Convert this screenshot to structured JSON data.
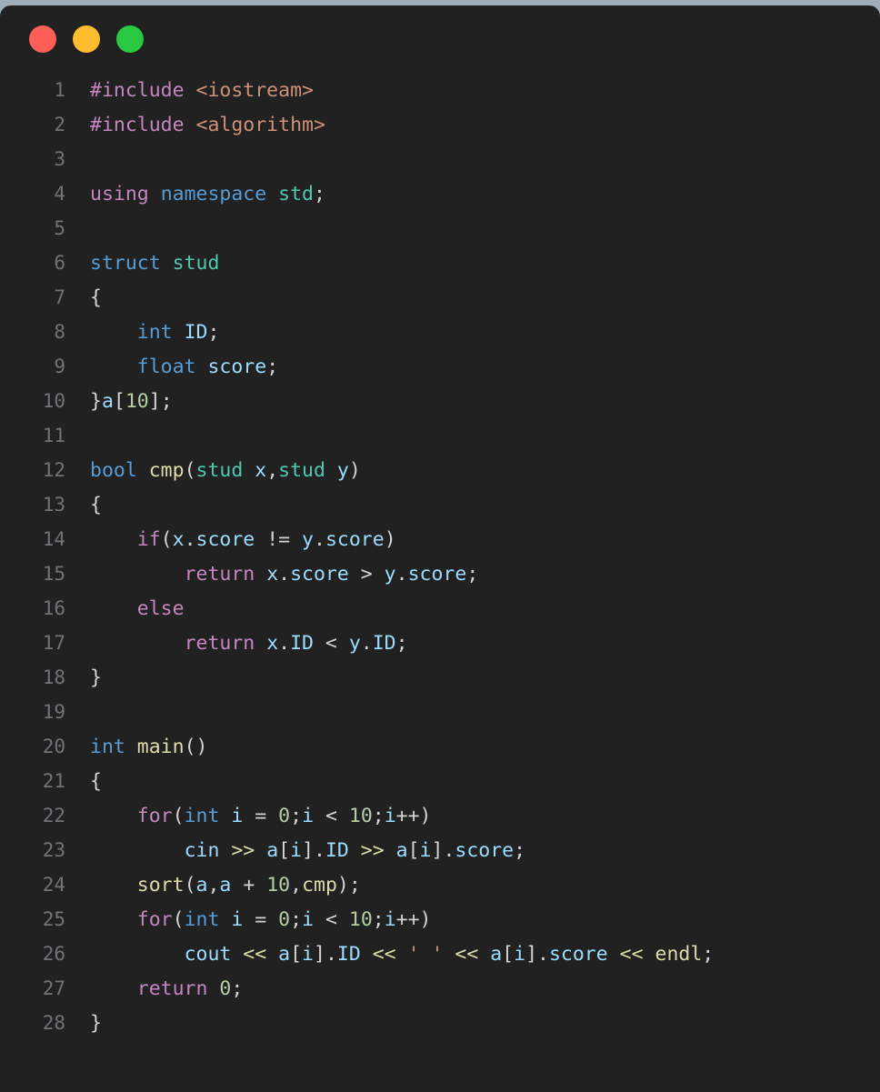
{
  "window": {
    "background_color": "#212121",
    "page_background_color": "#9FADB9",
    "traffic_lights": [
      {
        "name": "close",
        "color": "#FF5F57",
        "label": "Close"
      },
      {
        "name": "minimize",
        "color": "#FEBC2E",
        "label": "Minimize"
      },
      {
        "name": "maximize",
        "color": "#28C840",
        "label": "Maximize"
      }
    ]
  },
  "editor": {
    "language": "C++",
    "theme": "dark",
    "line_number_color": "#6F7478",
    "total_lines": 28,
    "lines": [
      {
        "n": "1",
        "text": "#include <iostream>"
      },
      {
        "n": "2",
        "text": "#include <algorithm>"
      },
      {
        "n": "3",
        "text": ""
      },
      {
        "n": "4",
        "text": "using namespace std;"
      },
      {
        "n": "5",
        "text": ""
      },
      {
        "n": "6",
        "text": "struct stud"
      },
      {
        "n": "7",
        "text": "{"
      },
      {
        "n": "8",
        "text": "    int ID;"
      },
      {
        "n": "9",
        "text": "    float score;"
      },
      {
        "n": "10",
        "text": "}a[10];"
      },
      {
        "n": "11",
        "text": ""
      },
      {
        "n": "12",
        "text": "bool cmp(stud x,stud y)"
      },
      {
        "n": "13",
        "text": "{"
      },
      {
        "n": "14",
        "text": "    if(x.score != y.score)"
      },
      {
        "n": "15",
        "text": "        return x.score > y.score;"
      },
      {
        "n": "16",
        "text": "    else"
      },
      {
        "n": "17",
        "text": "        return x.ID < y.ID;"
      },
      {
        "n": "18",
        "text": "}"
      },
      {
        "n": "19",
        "text": ""
      },
      {
        "n": "20",
        "text": "int main()"
      },
      {
        "n": "21",
        "text": "{"
      },
      {
        "n": "22",
        "text": "    for(int i = 0;i < 10;i++)"
      },
      {
        "n": "23",
        "text": "        cin >> a[i].ID >> a[i].score;"
      },
      {
        "n": "24",
        "text": "    sort(a,a + 10,cmp);"
      },
      {
        "n": "25",
        "text": "    for(int i = 0;i < 10;i++)"
      },
      {
        "n": "26",
        "text": "        cout << a[i].ID << ' ' << a[i].score << endl;"
      },
      {
        "n": "27",
        "text": "    return 0;"
      },
      {
        "n": "28",
        "text": "}"
      }
    ],
    "tokens": [
      [
        {
          "t": "#include",
          "c": "t-pre"
        },
        {
          "t": " ",
          "c": "t-op"
        },
        {
          "t": "<iostream>",
          "c": "t-str"
        }
      ],
      [
        {
          "t": "#include",
          "c": "t-pre"
        },
        {
          "t": " ",
          "c": "t-op"
        },
        {
          "t": "<algorithm>",
          "c": "t-str"
        }
      ],
      [],
      [
        {
          "t": "using",
          "c": "t-pre"
        },
        {
          "t": " ",
          "c": "t-op"
        },
        {
          "t": "namespace",
          "c": "t-kw"
        },
        {
          "t": " ",
          "c": "t-op"
        },
        {
          "t": "std",
          "c": "t-type"
        },
        {
          "t": ";",
          "c": "t-op"
        }
      ],
      [],
      [
        {
          "t": "struct",
          "c": "t-kw"
        },
        {
          "t": " ",
          "c": "t-op"
        },
        {
          "t": "stud",
          "c": "t-type"
        }
      ],
      [
        {
          "t": "{",
          "c": "t-op"
        }
      ],
      [
        {
          "t": "    ",
          "c": "t-op"
        },
        {
          "t": "int",
          "c": "t-kw"
        },
        {
          "t": " ",
          "c": "t-op"
        },
        {
          "t": "ID",
          "c": "t-var"
        },
        {
          "t": ";",
          "c": "t-op"
        }
      ],
      [
        {
          "t": "    ",
          "c": "t-op"
        },
        {
          "t": "float",
          "c": "t-kw"
        },
        {
          "t": " ",
          "c": "t-op"
        },
        {
          "t": "score",
          "c": "t-var"
        },
        {
          "t": ";",
          "c": "t-op"
        }
      ],
      [
        {
          "t": "}",
          "c": "t-op"
        },
        {
          "t": "a",
          "c": "t-var"
        },
        {
          "t": "[",
          "c": "t-op"
        },
        {
          "t": "10",
          "c": "t-num"
        },
        {
          "t": "];",
          "c": "t-op"
        }
      ],
      [],
      [
        {
          "t": "bool",
          "c": "t-kw"
        },
        {
          "t": " ",
          "c": "t-op"
        },
        {
          "t": "cmp",
          "c": "t-fn"
        },
        {
          "t": "(",
          "c": "t-op"
        },
        {
          "t": "stud",
          "c": "t-type"
        },
        {
          "t": " ",
          "c": "t-op"
        },
        {
          "t": "x",
          "c": "t-var"
        },
        {
          "t": ",",
          "c": "t-op"
        },
        {
          "t": "stud",
          "c": "t-type"
        },
        {
          "t": " ",
          "c": "t-op"
        },
        {
          "t": "y",
          "c": "t-var"
        },
        {
          "t": ")",
          "c": "t-op"
        }
      ],
      [
        {
          "t": "{",
          "c": "t-op"
        }
      ],
      [
        {
          "t": "    ",
          "c": "t-op"
        },
        {
          "t": "if",
          "c": "t-ctl"
        },
        {
          "t": "(",
          "c": "t-op"
        },
        {
          "t": "x",
          "c": "t-var"
        },
        {
          "t": ".",
          "c": "t-op"
        },
        {
          "t": "score",
          "c": "t-var"
        },
        {
          "t": " != ",
          "c": "t-op"
        },
        {
          "t": "y",
          "c": "t-var"
        },
        {
          "t": ".",
          "c": "t-op"
        },
        {
          "t": "score",
          "c": "t-var"
        },
        {
          "t": ")",
          "c": "t-op"
        }
      ],
      [
        {
          "t": "        ",
          "c": "t-op"
        },
        {
          "t": "return",
          "c": "t-ctl"
        },
        {
          "t": " ",
          "c": "t-op"
        },
        {
          "t": "x",
          "c": "t-var"
        },
        {
          "t": ".",
          "c": "t-op"
        },
        {
          "t": "score",
          "c": "t-var"
        },
        {
          "t": " > ",
          "c": "t-op"
        },
        {
          "t": "y",
          "c": "t-var"
        },
        {
          "t": ".",
          "c": "t-op"
        },
        {
          "t": "score",
          "c": "t-var"
        },
        {
          "t": ";",
          "c": "t-op"
        }
      ],
      [
        {
          "t": "    ",
          "c": "t-op"
        },
        {
          "t": "else",
          "c": "t-ctl"
        }
      ],
      [
        {
          "t": "        ",
          "c": "t-op"
        },
        {
          "t": "return",
          "c": "t-ctl"
        },
        {
          "t": " ",
          "c": "t-op"
        },
        {
          "t": "x",
          "c": "t-var"
        },
        {
          "t": ".",
          "c": "t-op"
        },
        {
          "t": "ID",
          "c": "t-var"
        },
        {
          "t": " < ",
          "c": "t-op"
        },
        {
          "t": "y",
          "c": "t-var"
        },
        {
          "t": ".",
          "c": "t-op"
        },
        {
          "t": "ID",
          "c": "t-var"
        },
        {
          "t": ";",
          "c": "t-op"
        }
      ],
      [
        {
          "t": "}",
          "c": "t-op"
        }
      ],
      [],
      [
        {
          "t": "int",
          "c": "t-kw"
        },
        {
          "t": " ",
          "c": "t-op"
        },
        {
          "t": "main",
          "c": "t-fn"
        },
        {
          "t": "()",
          "c": "t-op"
        }
      ],
      [
        {
          "t": "{",
          "c": "t-op"
        }
      ],
      [
        {
          "t": "    ",
          "c": "t-op"
        },
        {
          "t": "for",
          "c": "t-ctl"
        },
        {
          "t": "(",
          "c": "t-op"
        },
        {
          "t": "int",
          "c": "t-kw"
        },
        {
          "t": " ",
          "c": "t-op"
        },
        {
          "t": "i",
          "c": "t-var"
        },
        {
          "t": " = ",
          "c": "t-op"
        },
        {
          "t": "0",
          "c": "t-num"
        },
        {
          "t": ";",
          "c": "t-op"
        },
        {
          "t": "i",
          "c": "t-var"
        },
        {
          "t": " < ",
          "c": "t-op"
        },
        {
          "t": "10",
          "c": "t-num"
        },
        {
          "t": ";",
          "c": "t-op"
        },
        {
          "t": "i",
          "c": "t-var"
        },
        {
          "t": "++)",
          "c": "t-op"
        }
      ],
      [
        {
          "t": "        ",
          "c": "t-op"
        },
        {
          "t": "cin",
          "c": "t-var"
        },
        {
          "t": " ",
          "c": "t-op"
        },
        {
          "t": ">>",
          "c": "t-strop"
        },
        {
          "t": " ",
          "c": "t-op"
        },
        {
          "t": "a",
          "c": "t-var"
        },
        {
          "t": "[",
          "c": "t-op"
        },
        {
          "t": "i",
          "c": "t-var"
        },
        {
          "t": "].",
          "c": "t-op"
        },
        {
          "t": "ID",
          "c": "t-var"
        },
        {
          "t": " ",
          "c": "t-op"
        },
        {
          "t": ">>",
          "c": "t-strop"
        },
        {
          "t": " ",
          "c": "t-op"
        },
        {
          "t": "a",
          "c": "t-var"
        },
        {
          "t": "[",
          "c": "t-op"
        },
        {
          "t": "i",
          "c": "t-var"
        },
        {
          "t": "].",
          "c": "t-op"
        },
        {
          "t": "score",
          "c": "t-var"
        },
        {
          "t": ";",
          "c": "t-op"
        }
      ],
      [
        {
          "t": "    ",
          "c": "t-op"
        },
        {
          "t": "sort",
          "c": "t-fn"
        },
        {
          "t": "(",
          "c": "t-op"
        },
        {
          "t": "a",
          "c": "t-var"
        },
        {
          "t": ",",
          "c": "t-op"
        },
        {
          "t": "a",
          "c": "t-var"
        },
        {
          "t": " + ",
          "c": "t-op"
        },
        {
          "t": "10",
          "c": "t-num"
        },
        {
          "t": ",",
          "c": "t-op"
        },
        {
          "t": "cmp",
          "c": "t-fn"
        },
        {
          "t": ");",
          "c": "t-op"
        }
      ],
      [
        {
          "t": "    ",
          "c": "t-op"
        },
        {
          "t": "for",
          "c": "t-ctl"
        },
        {
          "t": "(",
          "c": "t-op"
        },
        {
          "t": "int",
          "c": "t-kw"
        },
        {
          "t": " ",
          "c": "t-op"
        },
        {
          "t": "i",
          "c": "t-var"
        },
        {
          "t": " = ",
          "c": "t-op"
        },
        {
          "t": "0",
          "c": "t-num"
        },
        {
          "t": ";",
          "c": "t-op"
        },
        {
          "t": "i",
          "c": "t-var"
        },
        {
          "t": " < ",
          "c": "t-op"
        },
        {
          "t": "10",
          "c": "t-num"
        },
        {
          "t": ";",
          "c": "t-op"
        },
        {
          "t": "i",
          "c": "t-var"
        },
        {
          "t": "++)",
          "c": "t-op"
        }
      ],
      [
        {
          "t": "        ",
          "c": "t-op"
        },
        {
          "t": "cout",
          "c": "t-var"
        },
        {
          "t": " ",
          "c": "t-op"
        },
        {
          "t": "<<",
          "c": "t-strop"
        },
        {
          "t": " ",
          "c": "t-op"
        },
        {
          "t": "a",
          "c": "t-var"
        },
        {
          "t": "[",
          "c": "t-op"
        },
        {
          "t": "i",
          "c": "t-var"
        },
        {
          "t": "].",
          "c": "t-op"
        },
        {
          "t": "ID",
          "c": "t-var"
        },
        {
          "t": " ",
          "c": "t-op"
        },
        {
          "t": "<<",
          "c": "t-strop"
        },
        {
          "t": " ",
          "c": "t-op"
        },
        {
          "t": "' '",
          "c": "t-str"
        },
        {
          "t": " ",
          "c": "t-op"
        },
        {
          "t": "<<",
          "c": "t-strop"
        },
        {
          "t": " ",
          "c": "t-op"
        },
        {
          "t": "a",
          "c": "t-var"
        },
        {
          "t": "[",
          "c": "t-op"
        },
        {
          "t": "i",
          "c": "t-var"
        },
        {
          "t": "].",
          "c": "t-op"
        },
        {
          "t": "score",
          "c": "t-var"
        },
        {
          "t": " ",
          "c": "t-op"
        },
        {
          "t": "<<",
          "c": "t-strop"
        },
        {
          "t": " ",
          "c": "t-op"
        },
        {
          "t": "endl",
          "c": "t-fn"
        },
        {
          "t": ";",
          "c": "t-op"
        }
      ],
      [
        {
          "t": "    ",
          "c": "t-op"
        },
        {
          "t": "return",
          "c": "t-ctl"
        },
        {
          "t": " ",
          "c": "t-op"
        },
        {
          "t": "0",
          "c": "t-num"
        },
        {
          "t": ";",
          "c": "t-op"
        }
      ],
      [
        {
          "t": "}",
          "c": "t-op"
        }
      ]
    ]
  }
}
